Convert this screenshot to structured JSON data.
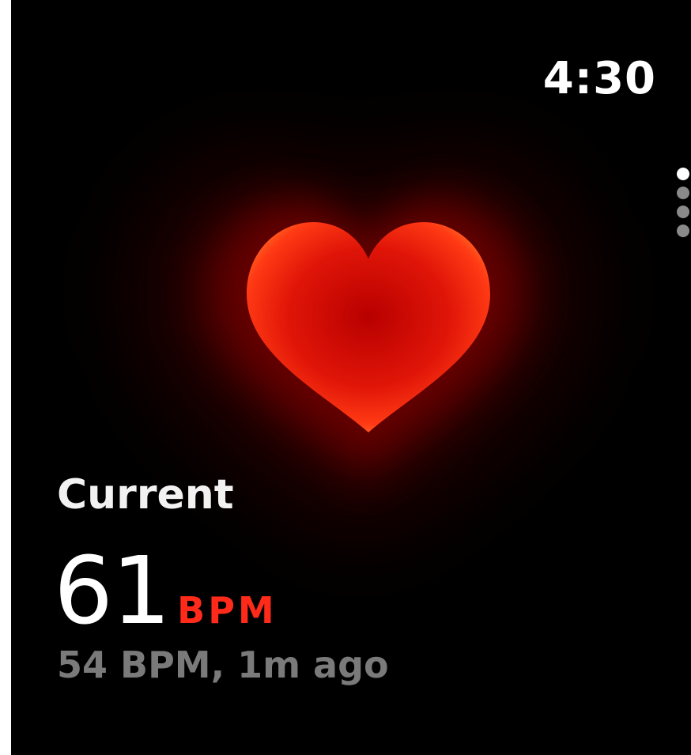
{
  "status_bar": {
    "time": "4:30"
  },
  "page_indicator": {
    "count": 4,
    "active_index": 0
  },
  "heart_rate": {
    "label": "Current",
    "value": "61",
    "unit": "BPM",
    "previous_reading": "54 BPM, 1m ago"
  },
  "colors": {
    "background": "#000000",
    "accent_red": "#ff2a1a",
    "secondary_text": "#7a7a7a"
  },
  "icons": {
    "heart": "heart-icon"
  }
}
